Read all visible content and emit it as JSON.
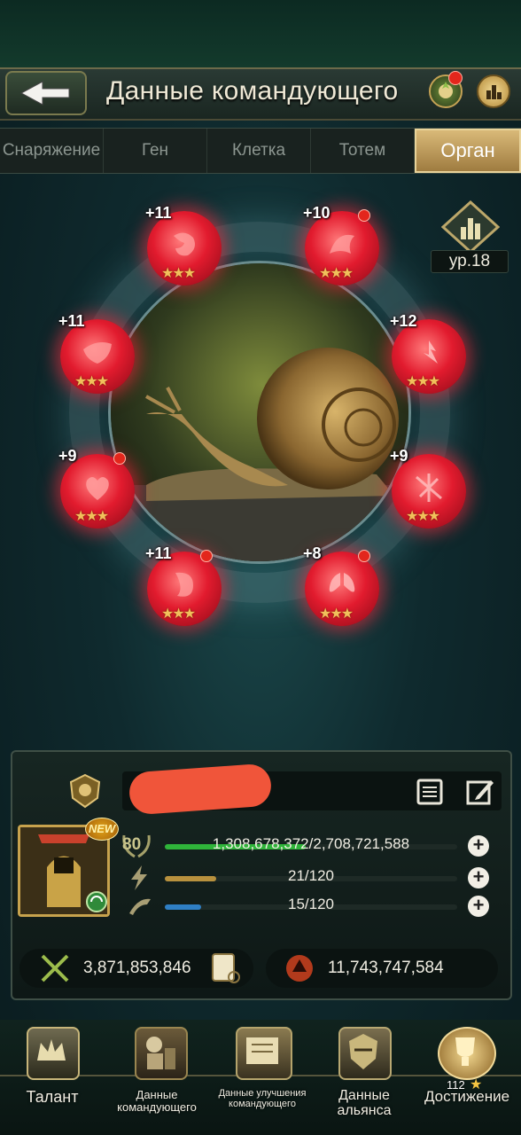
{
  "header": {
    "title": "Данные командующего"
  },
  "tabs": [
    {
      "label": "Снаряжение",
      "active": false
    },
    {
      "label": "Ген",
      "active": false
    },
    {
      "label": "Клетка",
      "active": false
    },
    {
      "label": "Тотем",
      "active": false
    },
    {
      "label": "Орган",
      "active": true
    }
  ],
  "level_badge": {
    "text": "ур.18"
  },
  "organs": [
    {
      "level": "+11",
      "stars": "★★★",
      "notify": false
    },
    {
      "level": "+10",
      "stars": "★★★",
      "notify": true
    },
    {
      "level": "+11",
      "stars": "★★★",
      "notify": false
    },
    {
      "level": "+12",
      "stars": "★★★",
      "notify": false
    },
    {
      "level": "+9",
      "stars": "★★★",
      "notify": true
    },
    {
      "level": "+9",
      "stars": "★★★",
      "notify": false
    },
    {
      "level": "+11",
      "stars": "★★★",
      "notify": true
    },
    {
      "level": "+8",
      "stars": "★★★",
      "notify": true
    }
  ],
  "commander": {
    "name_partial": "[",
    "level": "80",
    "new_badge": "NEW",
    "exp": {
      "text": "1,308,678,372/2,708,721,588",
      "fraction": 0.483
    },
    "stamina": {
      "text": "21/120",
      "fraction": 0.175
    },
    "energy": {
      "text": "15/120",
      "fraction": 0.125
    },
    "power": "3,871,853,846",
    "kills": "11,743,747,584"
  },
  "nav": [
    {
      "label": "Талант",
      "icon": "crown-shield-icon"
    },
    {
      "label": "Данные командующего",
      "icon": "commander-icon"
    },
    {
      "label": "Данные улучшения командующего",
      "icon": "scroll-icon"
    },
    {
      "label": "Данные альянса",
      "icon": "alliance-icon"
    },
    {
      "label": "Достижение",
      "icon": "trophy-icon",
      "badge": "112"
    }
  ],
  "colors": {
    "accent_gold": "#d9b978",
    "organ_red": "#e21b2e",
    "exp_green": "#2fb43a",
    "stamina_gold": "#b8913e",
    "energy_blue": "#2f7fc4"
  }
}
